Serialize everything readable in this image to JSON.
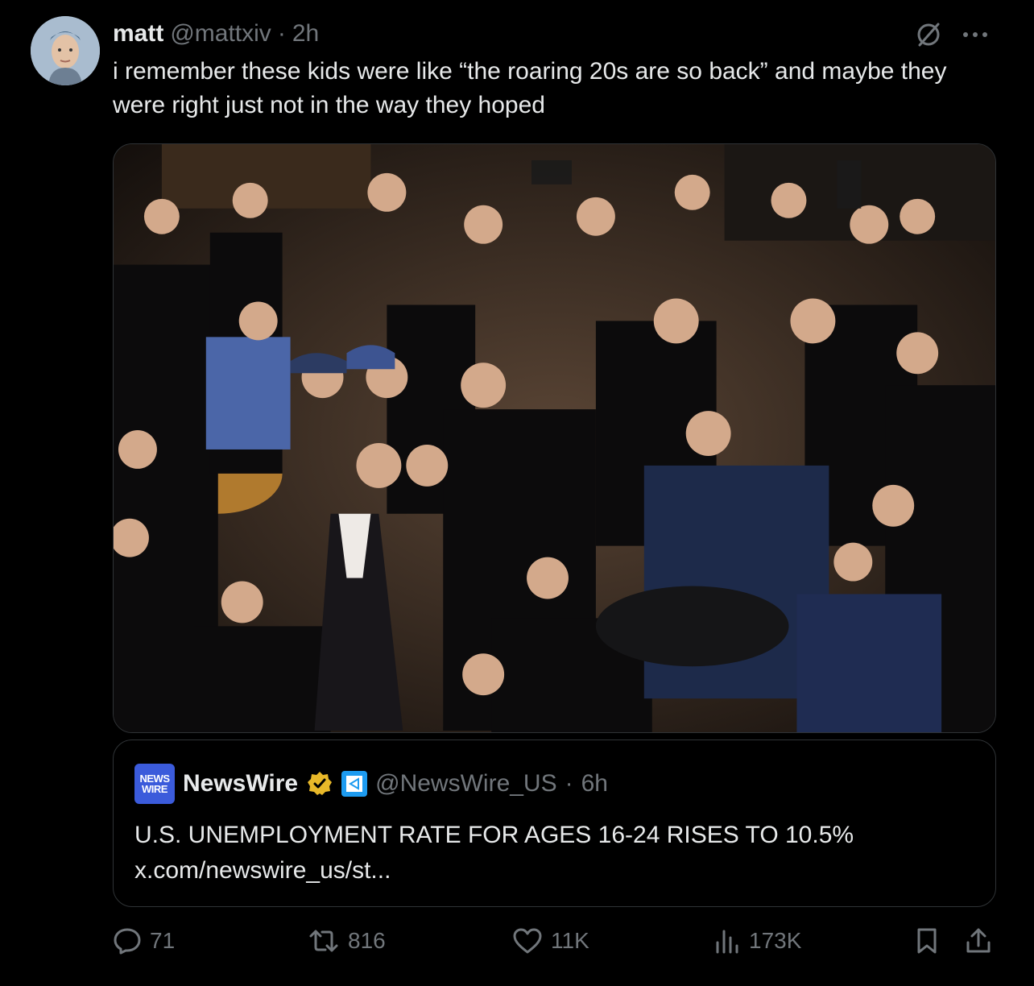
{
  "author": {
    "name": "matt",
    "handle": "@mattxiv",
    "separator": "·",
    "time": "2h"
  },
  "tweet": {
    "text": "i remember these kids were like “the roaring 20s are so back” and maybe they were right just not in the way they hoped"
  },
  "quote": {
    "logo_line1": "NEWS",
    "logo_line2": "WIRE",
    "name": "NewsWire",
    "handle": "@NewsWire_US",
    "separator": "·",
    "time": "6h",
    "text": "U.S. UNEMPLOYMENT RATE FOR AGES 16-24 RISES TO 10.5%",
    "link": "x.com/newswire_us/st..."
  },
  "actions": {
    "replies": "71",
    "reposts": "816",
    "likes": "11K",
    "views": "173K"
  },
  "icons": [
    "grok-icon",
    "more-icon",
    "verified-badge-icon",
    "affiliate-icon",
    "reply-icon",
    "repost-icon",
    "like-icon",
    "views-icon",
    "bookmark-icon",
    "share-icon"
  ],
  "colors": {
    "background": "#000000",
    "text": "#e7e9ea",
    "muted": "#71767b",
    "border": "#2f3336",
    "gold": "#e8b829",
    "blue": "#1d9bf0"
  }
}
